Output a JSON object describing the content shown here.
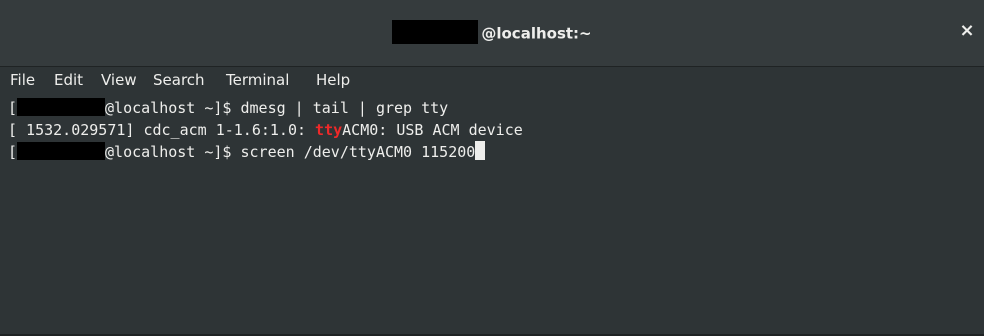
{
  "window": {
    "title_suffix": "@localhost:~",
    "close_glyph": "×"
  },
  "menu": {
    "file": "File",
    "edit": "Edit",
    "view": "View",
    "search": "Search",
    "terminal": "Terminal",
    "help": "Help"
  },
  "terminal": {
    "line1": {
      "open": "[",
      "prompt_suffix": "@localhost ~]$ ",
      "command": "dmesg | tail | grep tty"
    },
    "line2": {
      "before": "[ 1532.029571] cdc_acm 1-1.6:1.0: ",
      "highlight": "tty",
      "after": "ACM0: USB ACM device"
    },
    "line3": {
      "open": "[",
      "prompt_suffix": "@localhost ~]$ ",
      "command": "screen /dev/ttyACM0 115200"
    }
  },
  "colors": {
    "background": "#2e3436",
    "text": "#eeeeec",
    "highlight": "#ef2929"
  }
}
